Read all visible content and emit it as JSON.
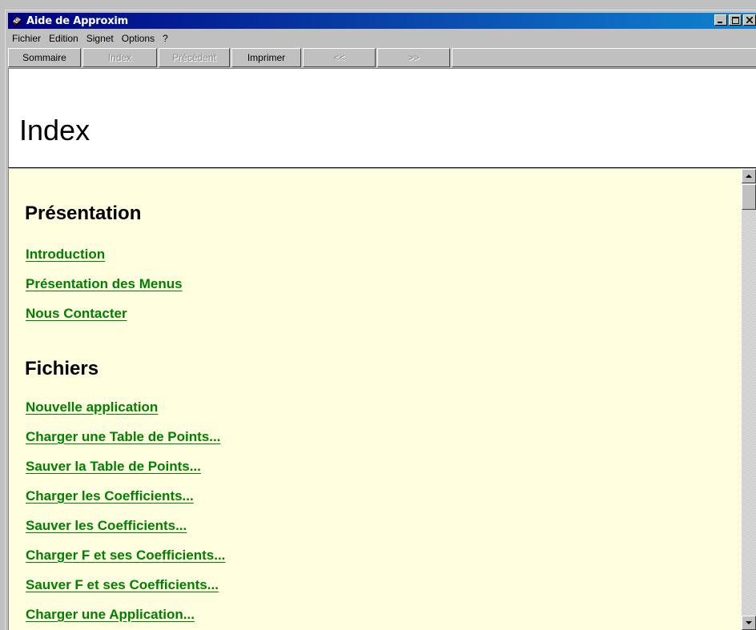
{
  "window": {
    "title": "Aide de Approxim"
  },
  "menu": [
    {
      "label": "Fichier"
    },
    {
      "label": "Edition"
    },
    {
      "label": "Signet"
    },
    {
      "label": "Options"
    },
    {
      "label": "?"
    }
  ],
  "buttons": {
    "sommaire": "Sommaire",
    "index": "Index",
    "precedent": "Précédent",
    "imprimer": "Imprimer",
    "back": "<<",
    "forward": ">>"
  },
  "header": {
    "title": "Index"
  },
  "sections": [
    {
      "heading": "Présentation",
      "links": [
        "Introduction",
        "Présentation des Menus",
        "Nous Contacter"
      ]
    },
    {
      "heading": "Fichiers",
      "links": [
        "Nouvelle application",
        "Charger une Table de Points...",
        "Sauver la Table de Points...",
        "Charger les Coefficients...",
        "Sauver les Coefficients...",
        "Charger F et ses Coefficients...",
        "Sauver F et ses Coefficients...",
        "Charger une Application..."
      ]
    }
  ],
  "colors": {
    "link": "#008000",
    "content_bg": "#ffffe0",
    "titlebar": "#000080"
  }
}
